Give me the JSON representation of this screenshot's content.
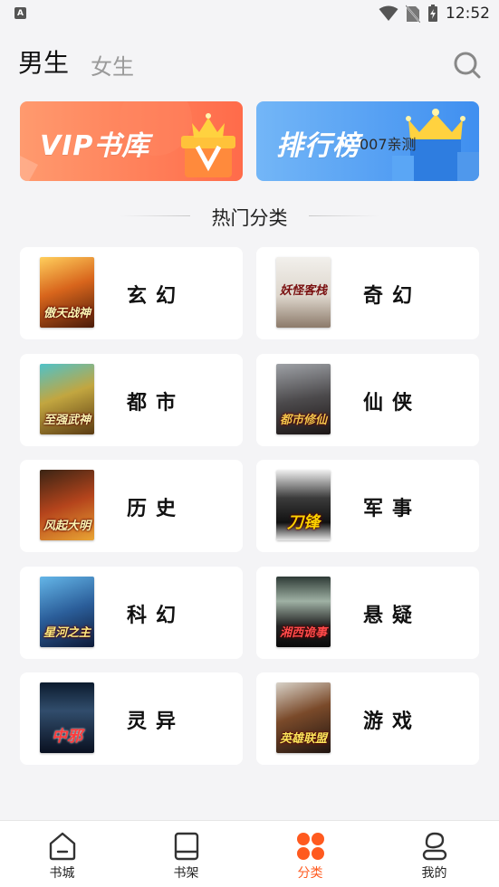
{
  "status_bar": {
    "time": "12:52",
    "app_badge": "A"
  },
  "header": {
    "tabs": [
      {
        "label": "男生",
        "active": true
      },
      {
        "label": "女生",
        "active": false
      }
    ]
  },
  "banners": {
    "vip": {
      "title": "VIP书库"
    },
    "rank": {
      "title": "排行榜",
      "watermark": "007亲测"
    }
  },
  "section": {
    "title": "热门分类"
  },
  "categories": [
    {
      "name": "玄幻",
      "cover_title": "傲天战神"
    },
    {
      "name": "奇幻",
      "cover_title": "妖怪客栈"
    },
    {
      "name": "都市",
      "cover_title": "至强武神"
    },
    {
      "name": "仙侠",
      "cover_title": "都市修仙"
    },
    {
      "name": "历史",
      "cover_title": "风起大明"
    },
    {
      "name": "军事",
      "cover_title": "刀锋"
    },
    {
      "name": "科幻",
      "cover_title": "星河之主"
    },
    {
      "name": "悬疑",
      "cover_title": "湘西诡事"
    },
    {
      "name": "灵异",
      "cover_title": "中邪"
    },
    {
      "name": "游戏",
      "cover_title": "英雄联盟"
    }
  ],
  "bottom_nav": [
    {
      "label": "书城",
      "icon": "home-icon"
    },
    {
      "label": "书架",
      "icon": "bookshelf-icon"
    },
    {
      "label": "分类",
      "icon": "category-grid-icon",
      "active": true
    },
    {
      "label": "我的",
      "icon": "profile-icon"
    }
  ],
  "colors": {
    "accent": "#ff5a1f",
    "background": "#f4f4f6",
    "card": "#ffffff"
  }
}
